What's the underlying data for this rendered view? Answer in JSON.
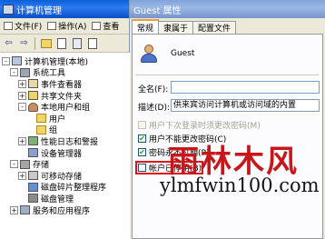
{
  "cm_window": {
    "title": "计算机管理",
    "menu": [
      {
        "label": "文件(F)",
        "icon": "file-menu-icon"
      },
      {
        "label": "操作(A)",
        "icon": "action-menu-icon"
      },
      {
        "label": "查看",
        "icon": "view-menu-icon"
      }
    ],
    "toolbar": [
      "back",
      "forward",
      "up-folder",
      "show-tree",
      "properties",
      "help"
    ],
    "tree": [
      {
        "label": "计算机管理(本地)",
        "indent": 0,
        "expander": "-",
        "icon": "computer-icon"
      },
      {
        "label": "系统工具",
        "indent": 1,
        "expander": "-",
        "icon": "tools-icon"
      },
      {
        "label": "事件查看器",
        "indent": 2,
        "expander": "+",
        "icon": "event-viewer-icon"
      },
      {
        "label": "共享文件夹",
        "indent": 2,
        "expander": "+",
        "icon": "shared-folder-icon"
      },
      {
        "label": "本地用户和组",
        "indent": 2,
        "expander": "-",
        "icon": "local-users-icon"
      },
      {
        "label": "用户",
        "indent": 3,
        "expander": "",
        "icon": "folder-icon",
        "selected": true
      },
      {
        "label": "组",
        "indent": 3,
        "expander": "",
        "icon": "folder-icon"
      },
      {
        "label": "性能日志和警报",
        "indent": 2,
        "expander": "+",
        "icon": "performance-icon"
      },
      {
        "label": "设备管理器",
        "indent": 2,
        "expander": "",
        "icon": "device-manager-icon"
      },
      {
        "label": "存储",
        "indent": 1,
        "expander": "-",
        "icon": "storage-icon"
      },
      {
        "label": "可移动存储",
        "indent": 2,
        "expander": "+",
        "icon": "removable-storage-icon"
      },
      {
        "label": "磁盘碎片整理程序",
        "indent": 2,
        "expander": "",
        "icon": "defrag-icon"
      },
      {
        "label": "磁盘管理",
        "indent": 2,
        "expander": "",
        "icon": "disk-management-icon"
      },
      {
        "label": "服务和应用程序",
        "indent": 1,
        "expander": "+",
        "icon": "services-icon"
      }
    ]
  },
  "prop_window": {
    "title": "Guest 属性",
    "tabs": [
      "常规",
      "隶属于",
      "配置文件"
    ],
    "active_tab": 0,
    "username": "Guest",
    "full_name_label": "全名(F):",
    "full_name_value": "",
    "description_label": "描述(D):",
    "description_value": "供来宾访问计算机或访问域的内置",
    "checkboxes": [
      {
        "label": "用户下次登录时须更改密码(M)",
        "checked": false,
        "disabled": true
      },
      {
        "label": "用户不能更改密码(C)",
        "checked": true,
        "disabled": false
      },
      {
        "label": "密码永不过期(P)",
        "checked": true,
        "disabled": false
      },
      {
        "label": "帐户已停用(B)",
        "checked": false,
        "disabled": false
      }
    ]
  },
  "watermark": {
    "text_cn": "雨林木风",
    "url": "ylmfwin100.com",
    "color": "#c8171a"
  }
}
